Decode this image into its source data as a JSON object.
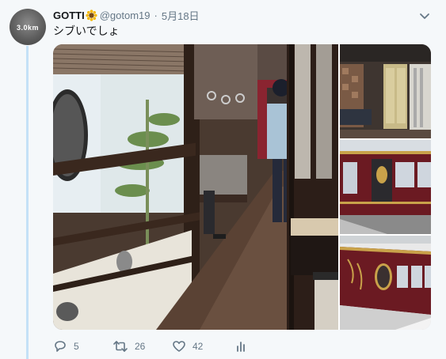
{
  "avatar": {
    "text": "3.0km"
  },
  "tweet": {
    "display_name": "GOTTI",
    "emoji_icon": "sunflower-icon",
    "handle": "@gotom19",
    "separator": "·",
    "date": "5月18日",
    "text": "シブいでしょ"
  },
  "media": {
    "photos": [
      {
        "name": "photo-train-interior"
      },
      {
        "name": "photo-train-doorway"
      },
      {
        "name": "photo-train-exterior-side"
      },
      {
        "name": "photo-train-exterior-platform"
      }
    ]
  },
  "actions": {
    "reply_count": "5",
    "retweet_count": "26",
    "like_count": "42"
  },
  "colors": {
    "background": "#f5f8fa",
    "thread_line": "#c4e1f7",
    "secondary_text": "#657786",
    "train_maroon": "#6b1a22"
  }
}
